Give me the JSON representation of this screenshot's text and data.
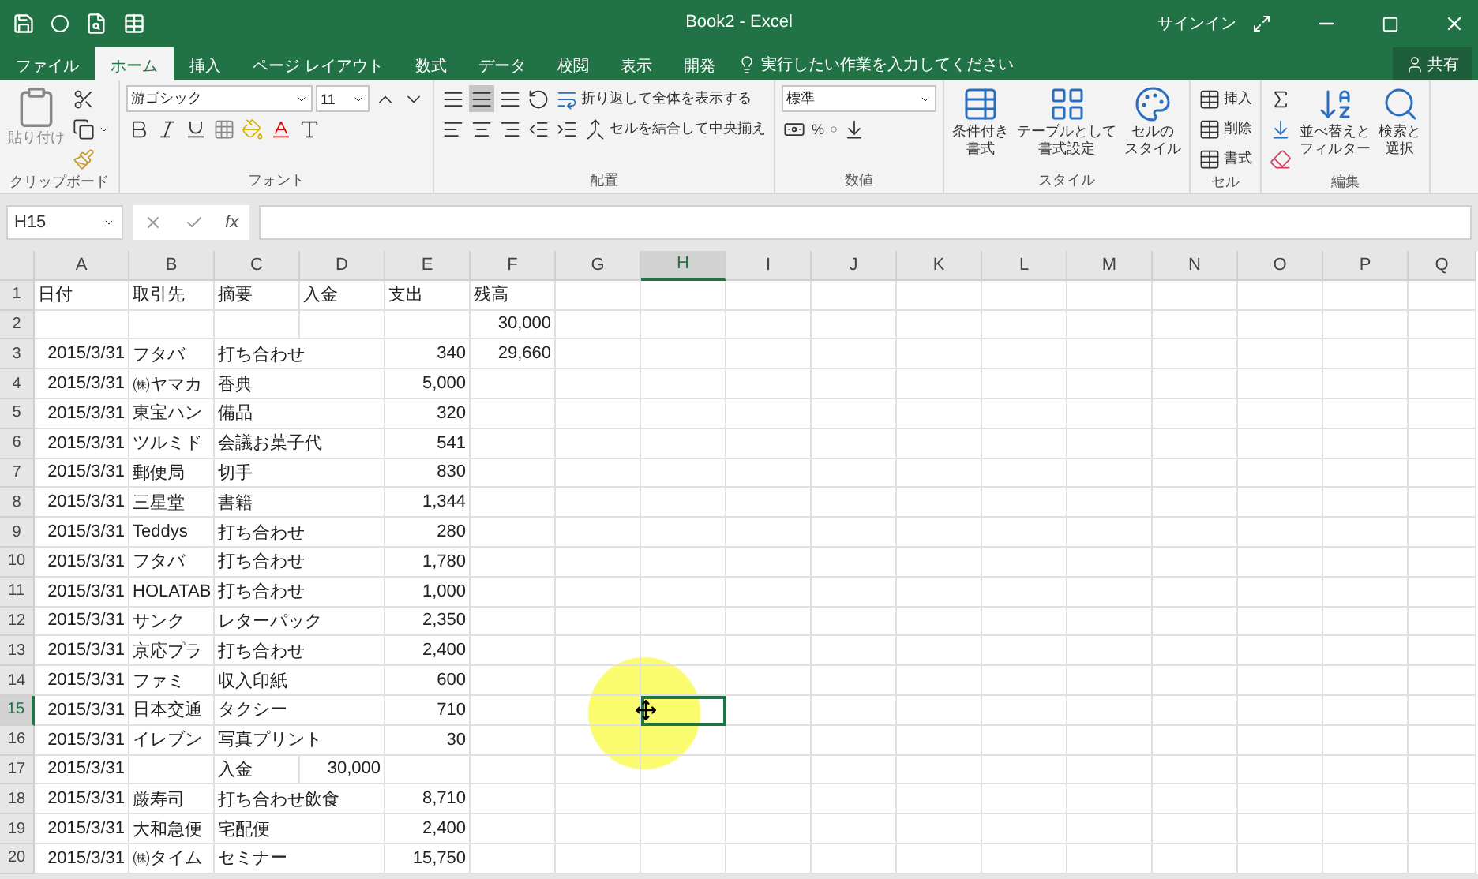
{
  "window": {
    "title": "Book2 - Excel",
    "sign_in": "サインイン"
  },
  "tabs": [
    {
      "label": "ファイル",
      "selected": false
    },
    {
      "label": "ホーム",
      "selected": true
    },
    {
      "label": "挿入",
      "selected": false
    },
    {
      "label": "ページ レイアウト",
      "selected": false
    },
    {
      "label": "数式",
      "selected": false
    },
    {
      "label": "データ",
      "selected": false
    },
    {
      "label": "校閲",
      "selected": false
    },
    {
      "label": "表示",
      "selected": false
    },
    {
      "label": "開発",
      "selected": false
    }
  ],
  "tell_me": {
    "placeholder": "実行したい作業を入力してください"
  },
  "share": "共有",
  "ribbon": [
    {
      "kind": "clipboard",
      "label": "クリップボード",
      "paste": "貼り付け"
    },
    {
      "kind": "font",
      "label": "フォント",
      "font_name": "游ゴシック",
      "font_size": "11"
    },
    {
      "kind": "alignment",
      "label": "配置",
      "wrap": "折り返して全体を表示する",
      "merge": "セルを結合して中央揃え",
      "vertical_align": [
        {
          "selected": false
        },
        {
          "selected": true
        },
        {
          "selected": false
        }
      ]
    },
    {
      "kind": "number",
      "label": "数値",
      "format": "標準",
      "percent": "%"
    },
    {
      "kind": "styles",
      "label": "スタイル",
      "buttons": [
        [
          "条件付き",
          "書式"
        ],
        [
          "テーブルとして",
          "書式設定"
        ],
        [
          "セルの",
          "スタイル"
        ]
      ]
    },
    {
      "kind": "cells",
      "label": "セル",
      "buttons": [
        "挿入",
        "削除",
        "書式"
      ]
    },
    {
      "kind": "editing",
      "label": "編集",
      "buttons": [
        [
          "並べ替えと",
          "フィルター"
        ],
        [
          "検索と",
          "選択"
        ]
      ]
    }
  ],
  "formula_bar": {
    "name_box": "H15",
    "fx": "fx"
  },
  "columns": [
    {
      "label": "A",
      "selected": false
    },
    {
      "label": "B",
      "selected": false
    },
    {
      "label": "C",
      "selected": false
    },
    {
      "label": "D",
      "selected": false
    },
    {
      "label": "E",
      "selected": false
    },
    {
      "label": "F",
      "selected": false
    },
    {
      "label": "G",
      "selected": false
    },
    {
      "label": "H",
      "selected": true
    },
    {
      "label": "I",
      "selected": false
    },
    {
      "label": "J",
      "selected": false
    },
    {
      "label": "K",
      "selected": false
    },
    {
      "label": "L",
      "selected": false
    },
    {
      "label": "M",
      "selected": false
    },
    {
      "label": "N",
      "selected": false
    },
    {
      "label": "O",
      "selected": false
    },
    {
      "label": "P",
      "selected": false
    },
    {
      "label": "Q",
      "selected": false
    }
  ],
  "rows": [
    {
      "number": "1",
      "selected": false,
      "cells": [
        "日付",
        "取引先",
        "摘要",
        "入金",
        "支出",
        "残高"
      ]
    },
    {
      "number": "2",
      "selected": false,
      "cells": [
        "",
        "",
        "",
        "",
        "",
        "30,000"
      ]
    },
    {
      "number": "3",
      "selected": false,
      "cells": [
        "2015/3/31",
        "フタバ",
        "打ち合わせ",
        "",
        "340",
        "29,660"
      ]
    },
    {
      "number": "4",
      "selected": false,
      "cells": [
        "2015/3/31",
        "㈱ヤマカ",
        "香典",
        "",
        "5,000",
        ""
      ]
    },
    {
      "number": "5",
      "selected": false,
      "cells": [
        "2015/3/31",
        "東宝ハン",
        "備品",
        "",
        "320",
        ""
      ]
    },
    {
      "number": "6",
      "selected": false,
      "cells": [
        "2015/3/31",
        "ツルミド",
        "会議お菓子代",
        "",
        "541",
        ""
      ]
    },
    {
      "number": "7",
      "selected": false,
      "cells": [
        "2015/3/31",
        "郵便局",
        "切手",
        "",
        "830",
        ""
      ]
    },
    {
      "number": "8",
      "selected": false,
      "cells": [
        "2015/3/31",
        "三星堂",
        "書籍",
        "",
        "1,344",
        ""
      ]
    },
    {
      "number": "9",
      "selected": false,
      "cells": [
        "2015/3/31",
        "Teddys",
        "打ち合わせ",
        "",
        "280",
        ""
      ]
    },
    {
      "number": "10",
      "selected": false,
      "cells": [
        "2015/3/31",
        "フタバ",
        "打ち合わせ",
        "",
        "1,780",
        ""
      ]
    },
    {
      "number": "11",
      "selected": false,
      "cells": [
        "2015/3/31",
        "HOLATAB",
        "打ち合わせ",
        "",
        "1,000",
        ""
      ]
    },
    {
      "number": "12",
      "selected": false,
      "cells": [
        "2015/3/31",
        "サンク",
        "レターパック",
        "",
        "2,350",
        ""
      ]
    },
    {
      "number": "13",
      "selected": false,
      "cells": [
        "2015/3/31",
        "京応プラ",
        "打ち合わせ",
        "",
        "2,400",
        ""
      ]
    },
    {
      "number": "14",
      "selected": false,
      "cells": [
        "2015/3/31",
        "ファミ",
        "収入印紙",
        "",
        "600",
        ""
      ]
    },
    {
      "number": "15",
      "selected": true,
      "cells": [
        "2015/3/31",
        "日本交通",
        "タクシー",
        "",
        "710",
        ""
      ]
    },
    {
      "number": "16",
      "selected": false,
      "cells": [
        "2015/3/31",
        "イレブン",
        "写真プリント",
        "",
        "30",
        ""
      ]
    },
    {
      "number": "17",
      "selected": false,
      "cells": [
        "2015/3/31",
        "",
        "入金",
        "30,000",
        "",
        ""
      ]
    },
    {
      "number": "18",
      "selected": false,
      "cells": [
        "2015/3/31",
        "厳寿司",
        "打ち合わせ飲食",
        "",
        "8,710",
        ""
      ]
    },
    {
      "number": "19",
      "selected": false,
      "cells": [
        "2015/3/31",
        "大和急便",
        "宅配便",
        "",
        "2,400",
        ""
      ]
    },
    {
      "number": "20",
      "selected": false,
      "cells": [
        "2015/3/31",
        "㈱タイム",
        "セミナー",
        "",
        "15,750",
        ""
      ]
    }
  ]
}
